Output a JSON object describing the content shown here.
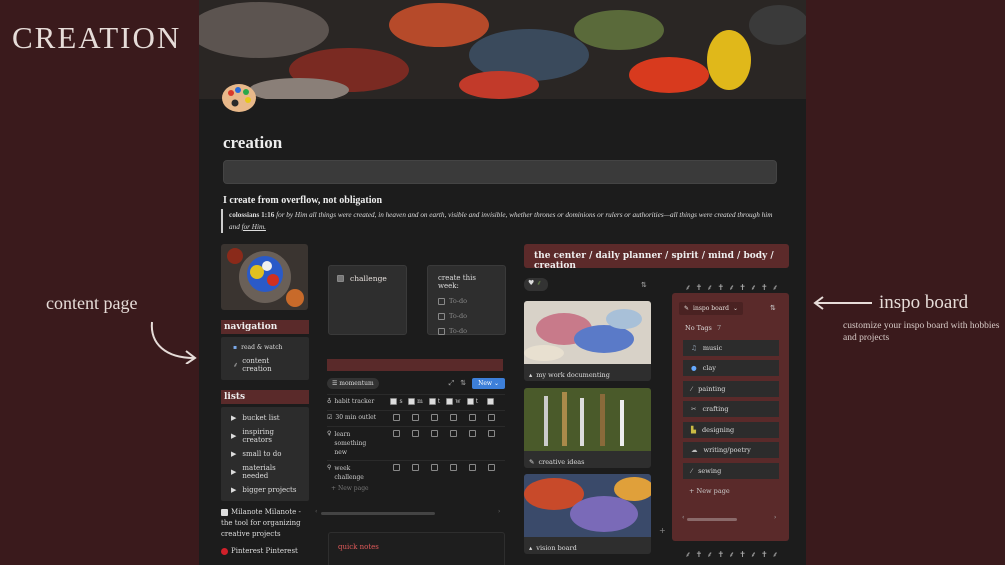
{
  "outer": {
    "title": "CREATION",
    "content_page_label": "content page",
    "inspo_board_label": "inspo board",
    "inspo_board_sub": "customize your inspo board with hobbies and projects"
  },
  "page": {
    "title": "creation",
    "callout_title": "I create from overflow, not obligation",
    "verse_ref": "colossians 1:16",
    "verse_text": "for by Him all things were created, in heaven and on earth, visible and invisible, whether thrones or dominions or rulers or authorities—all things were created through him and",
    "verse_end": "for Him."
  },
  "navigation": {
    "header": "navigation",
    "items": [
      {
        "label": "read & watch",
        "icon": "book-icon"
      },
      {
        "label": "content creation",
        "icon": "brush-icon"
      }
    ]
  },
  "lists": {
    "header": "lists",
    "items": [
      "bucket list",
      "inspiring creators",
      "small to do",
      "materials needed",
      "bigger projects"
    ]
  },
  "external": {
    "milanote_prefix": "Milanote",
    "milanote_text": "Milanote - the tool for organizing creative projects",
    "pinterest_prefix": "Pinterest",
    "pinterest_text": "Pinterest"
  },
  "challenge_card": {
    "label": "challenge"
  },
  "week_card": {
    "title": "create this week:",
    "todos": [
      "To-do",
      "To-do",
      "To-do"
    ]
  },
  "momentum": {
    "view_label": "momentum",
    "new_label": "New",
    "header_name": "habit tracker",
    "days": [
      "s",
      "m",
      "t",
      "w",
      "t",
      ""
    ],
    "rows": [
      {
        "name": "30 min outlet"
      },
      {
        "name": "learn something new"
      },
      {
        "name": "week challenge"
      }
    ],
    "new_page": "New page"
  },
  "quick_notes": {
    "label": "quick notes"
  },
  "center_bar": {
    "label": "the center / daily planner / spirit / mind / body / creation"
  },
  "gallery": [
    {
      "label": "my work documenting"
    },
    {
      "label": "creative ideas"
    },
    {
      "label": "vision board"
    }
  ],
  "inspo": {
    "view_label": "inspo board",
    "no_tags_label": "No Tags",
    "no_tags_count": "7",
    "tags": [
      "music",
      "clay",
      "painting",
      "crafting",
      "designing",
      "writing/poetry",
      "sewing"
    ],
    "new_page": "New page"
  },
  "colors": {
    "background": "#3a1a1c",
    "accent_maroon": "#5a2a2a",
    "new_button": "#3d7fd9"
  }
}
